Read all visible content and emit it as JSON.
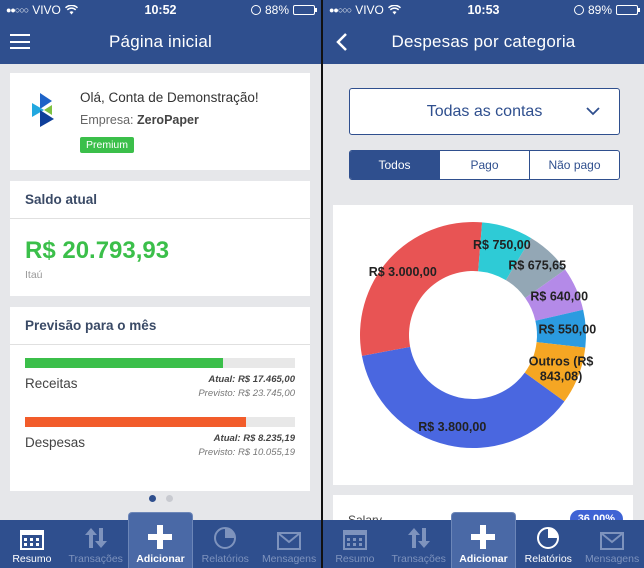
{
  "left": {
    "status": {
      "carrier": "VIVO",
      "time": "10:52",
      "battery": "88%",
      "battery_level": 0.88
    },
    "title": "Página inicial",
    "company_card": {
      "greeting": "Olá, Conta de Demonstração!",
      "company_label": "Empresa:",
      "company_name": "ZeroPaper",
      "badge": "Premium"
    },
    "balance": {
      "title": "Saldo atual",
      "value": "R$ 20.793,93",
      "bank": "Itaú",
      "color": "#3bbf4a"
    },
    "forecast": {
      "title": "Previsão para o mês",
      "income": {
        "label": "Receitas",
        "atual": "Atual: R$ 17.465,00",
        "previsto": "Previsto: R$ 23.745,00",
        "progress": 0.735,
        "color": "#3bbf4a"
      },
      "expenses": {
        "label": "Despesas",
        "atual": "Atual: R$ 8.235,19",
        "previsto": "Previsto: R$ 10.055,19",
        "progress": 0.819,
        "color": "#f25c2a"
      }
    },
    "tabs": [
      {
        "label": "Resumo",
        "icon": "calendar-icon"
      },
      {
        "label": "Transações",
        "icon": "arrows-updown-icon"
      },
      {
        "label": "Adicionar",
        "icon": "plus-icon"
      },
      {
        "label": "Relatórios",
        "icon": "pie-chart-icon"
      },
      {
        "label": "Mensagens",
        "icon": "envelope-icon"
      }
    ]
  },
  "right": {
    "status": {
      "carrier": "VIVO",
      "time": "10:53",
      "battery": "89%",
      "battery_level": 0.89
    },
    "title": "Despesas por categoria",
    "account_select": "Todas as contas",
    "filters": [
      "Todos",
      "Pago",
      "Não pago"
    ],
    "peek": {
      "label": "Salary",
      "badge": "36,00%"
    },
    "tabs": [
      {
        "label": "Resumo",
        "icon": "calendar-icon"
      },
      {
        "label": "Transações",
        "icon": "arrows-updown-icon"
      },
      {
        "label": "Adicionar",
        "icon": "plus-icon"
      },
      {
        "label": "Relatórios",
        "icon": "pie-chart-icon"
      },
      {
        "label": "Mensagens",
        "icon": "envelope-icon"
      }
    ]
  },
  "chart_data": {
    "type": "pie",
    "donut": true,
    "slices": [
      {
        "label": "R$ 3.800,00",
        "value": 3800.0,
        "color": "#4a67e0"
      },
      {
        "label": "R$ 3.000,00",
        "value": 3000.0,
        "color": "#e85454"
      },
      {
        "label": "R$ 750,00",
        "value": 750.0,
        "color": "#2ecbd6"
      },
      {
        "label": "R$ 675,65",
        "value": 675.65,
        "color": "#93a7b5"
      },
      {
        "label": "R$ 640,00",
        "value": 640.0,
        "color": "#b48ae8"
      },
      {
        "label": "R$ 550,00",
        "value": 550.0,
        "color": "#2b9be0"
      },
      {
        "label": "Outros (R$ 843,08)",
        "value": 843.08,
        "color": "#f5a623"
      }
    ],
    "extra_slice_color": "#2fcfa5"
  }
}
